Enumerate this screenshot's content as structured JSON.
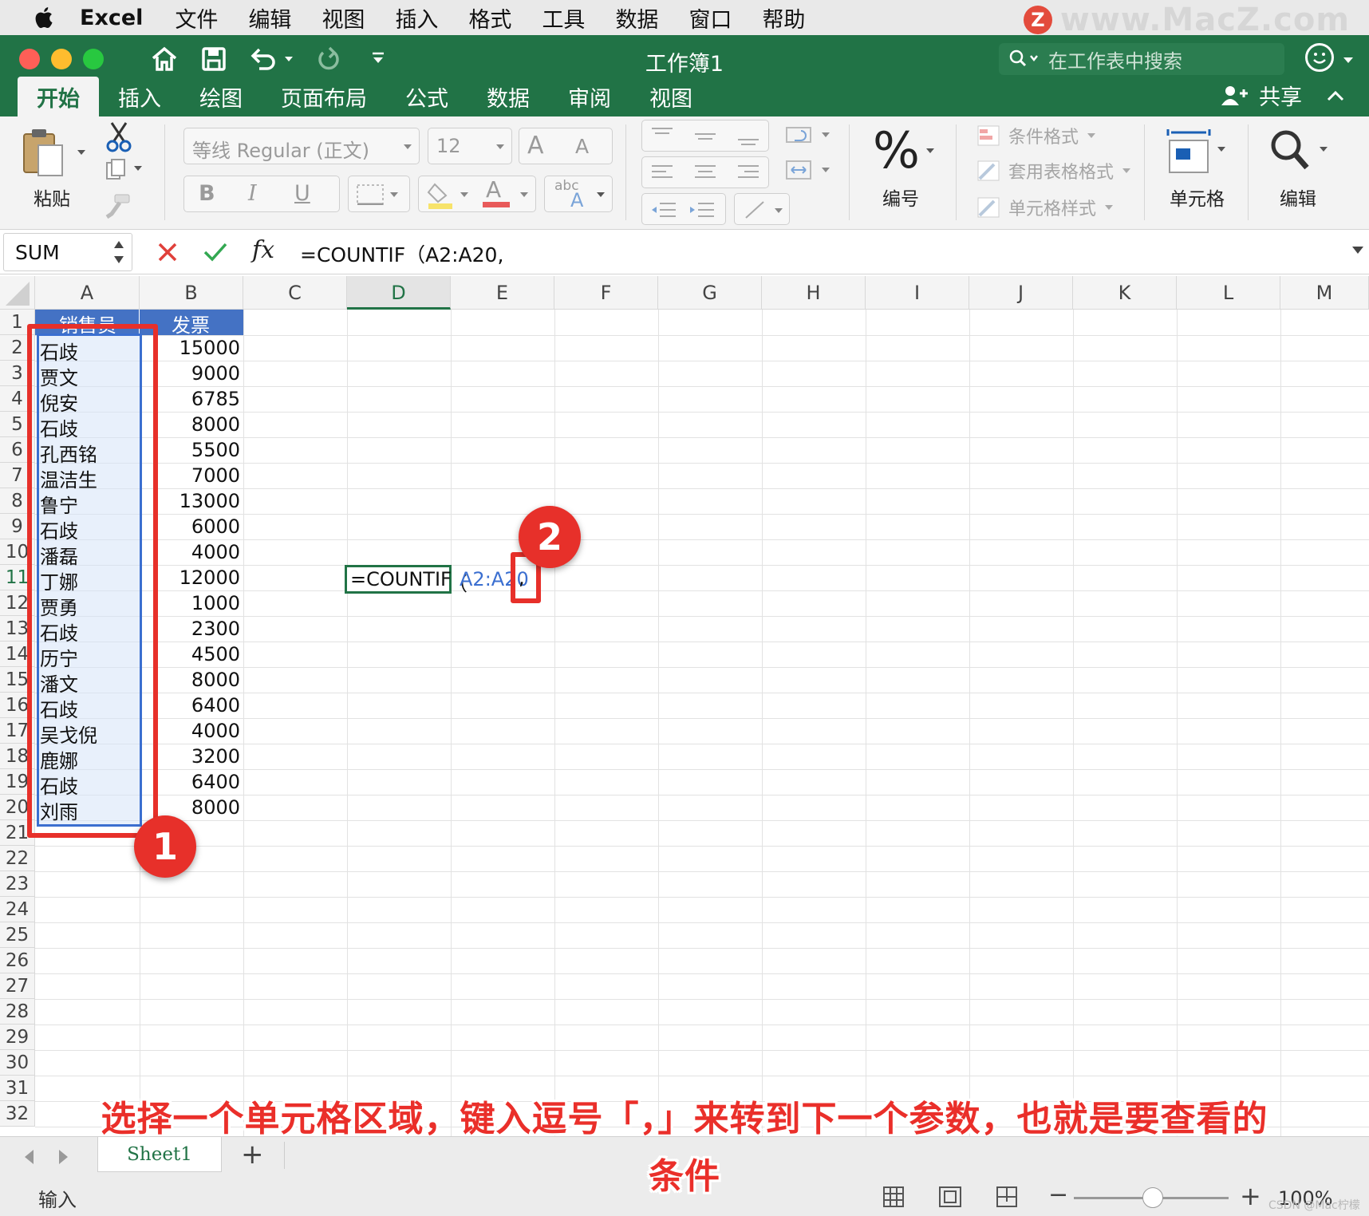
{
  "menubar": {
    "app": "Excel",
    "items": [
      "文件",
      "编辑",
      "视图",
      "插入",
      "格式",
      "工具",
      "数据",
      "窗口",
      "帮助"
    ],
    "watermark": "www.MacZ.com",
    "watermark_logo": "Z"
  },
  "titlebar": {
    "document_title": "工作簿1",
    "search_placeholder": "在工作表中搜索",
    "share_label": "共享",
    "tabs": [
      "开始",
      "插入",
      "绘图",
      "页面布局",
      "公式",
      "数据",
      "审阅",
      "视图"
    ],
    "active_tab": "开始"
  },
  "ribbon": {
    "paste_label": "粘贴",
    "font_name": "等线 Regular (正文)",
    "font_size": "12",
    "bold": "B",
    "italic": "I",
    "underline": "U",
    "number_format_symbol": "%",
    "number_label": "编号",
    "conditional_format": "条件格式",
    "table_format": "套用表格格式",
    "cell_styles": "单元格样式",
    "cells_label": "单元格",
    "editing_label": "编辑",
    "grow_font": "A",
    "shrink_font": "A",
    "font_color_letter": "A",
    "abc_label": "abc"
  },
  "formula_bar": {
    "name_box": "SUM",
    "fx": "fx",
    "formula": "=COUNTIF（A2:A20,"
  },
  "sheet": {
    "columns": [
      "A",
      "B",
      "C",
      "D",
      "E",
      "F",
      "G",
      "H",
      "I",
      "J",
      "K",
      "L",
      "M"
    ],
    "selected_column": "D",
    "selected_row": 11,
    "row_numbers": [
      1,
      2,
      3,
      4,
      5,
      6,
      7,
      8,
      9,
      10,
      11,
      12,
      13,
      14,
      15,
      16,
      17,
      18,
      19,
      20,
      21,
      22,
      23,
      24,
      25,
      26,
      27,
      28,
      29,
      30,
      31,
      32
    ],
    "header_a": "销售员",
    "header_b": "发票",
    "salespeople": [
      "石歧",
      "贾文",
      "倪安",
      "石歧",
      "孔西铭",
      "温洁生",
      "鲁宁",
      "石歧",
      "潘磊",
      "丁娜",
      "贾勇",
      "石歧",
      "历宁",
      "潘文",
      "石歧",
      "吴戈倪",
      "鹿娜",
      "石歧",
      "刘雨"
    ],
    "invoices": [
      "15000",
      "9000",
      "6785",
      "8000",
      "5500",
      "7000",
      "13000",
      "6000",
      "4000",
      "12000",
      "1000",
      "2300",
      "4500",
      "8000",
      "6400",
      "4000",
      "3200",
      "6400",
      "8000"
    ],
    "editing_cell_text": "=COUNTIF",
    "editing_overflow_paren": "（",
    "editing_overflow_ref": "A2:A20",
    "editing_overflow_comma": ","
  },
  "annotations": {
    "badge_1": "1",
    "badge_2": "2",
    "caption_line1": "选择一个单元格区域，键入逗号「，」来转到下一个参数，也就是要查看的",
    "caption_line2": "条件"
  },
  "sheet_tabs": {
    "active": "Sheet1",
    "add": "+"
  },
  "status": {
    "mode": "输入",
    "zoom": "100%",
    "credit": "CSDN @Mac柠檬"
  },
  "colors": {
    "excel_green": "#217346",
    "header_blue": "#4472c4",
    "annotation_red": "#e7302a",
    "range_blue": "#3b6fd0"
  }
}
